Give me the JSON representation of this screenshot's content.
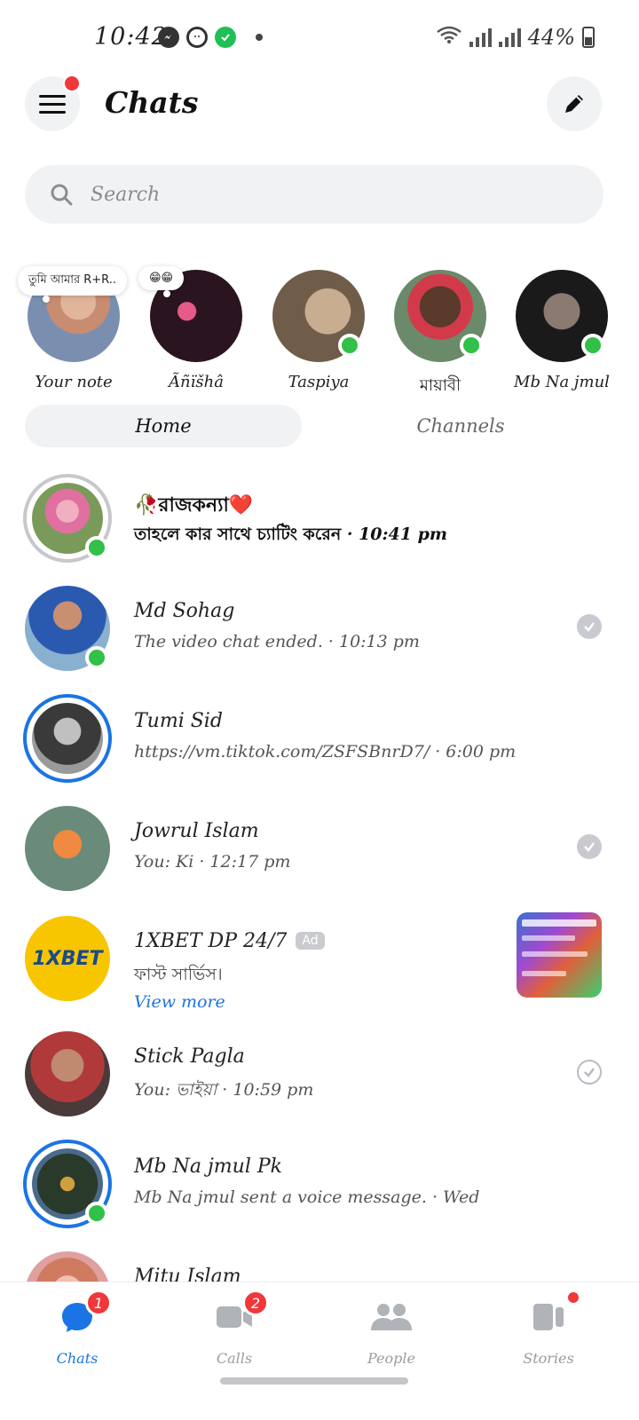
{
  "status_bar": {
    "time": "10:42",
    "battery": "44%"
  },
  "header": {
    "title": "Chats"
  },
  "search": {
    "placeholder": "Search"
  },
  "notes": [
    {
      "name": "Your note",
      "note_text": "তুমি আমার R+R.."
    },
    {
      "name": "Ãñïšhâ",
      "note_text": "😁😁"
    },
    {
      "name": "Taspiya"
    },
    {
      "name": "মায়াবী"
    },
    {
      "name": "Mb Na jmul"
    }
  ],
  "segments": {
    "home": "Home",
    "channels": "Channels"
  },
  "chats": [
    {
      "name": "🥀রাজকন্যা❤️",
      "preview": "তাহলে কার সাথে চ্যাটিং করেন",
      "time": " · 10:41 pm"
    },
    {
      "name": "Md Sohag",
      "preview": "The video chat ended.",
      "time": " · 10:13 pm"
    },
    {
      "name": "Tumi Sid",
      "preview": "https://vm.tiktok.com/ZSFSBnrD7/",
      "time": " · 6:00 pm"
    },
    {
      "name": "Jowrul Islam",
      "preview": "You: Ki",
      "time": " · 12:17 pm"
    },
    {
      "name": "1XBET DP 24/7",
      "ad_label": "Ad",
      "preview": "ফাস্ট সার্ভিস।",
      "cta": "View more",
      "logo_text": "1XBET"
    },
    {
      "name": "Stick Pagla",
      "preview": "You: ভাইয়া",
      "time": " · 10:59 pm"
    },
    {
      "name": "Mb Na jmul Pk",
      "preview": "Mb Na jmul sent a voice message.",
      "time": " · Wed"
    },
    {
      "name": "Mitu Islam"
    }
  ],
  "bottom_nav": [
    {
      "label": "Chats",
      "badge": "1"
    },
    {
      "label": "Calls",
      "badge": "2"
    },
    {
      "label": "People"
    },
    {
      "label": "Stories"
    }
  ],
  "colors": {
    "accent": "#1b74e4",
    "online": "#31c048",
    "badge": "#f0373a"
  }
}
